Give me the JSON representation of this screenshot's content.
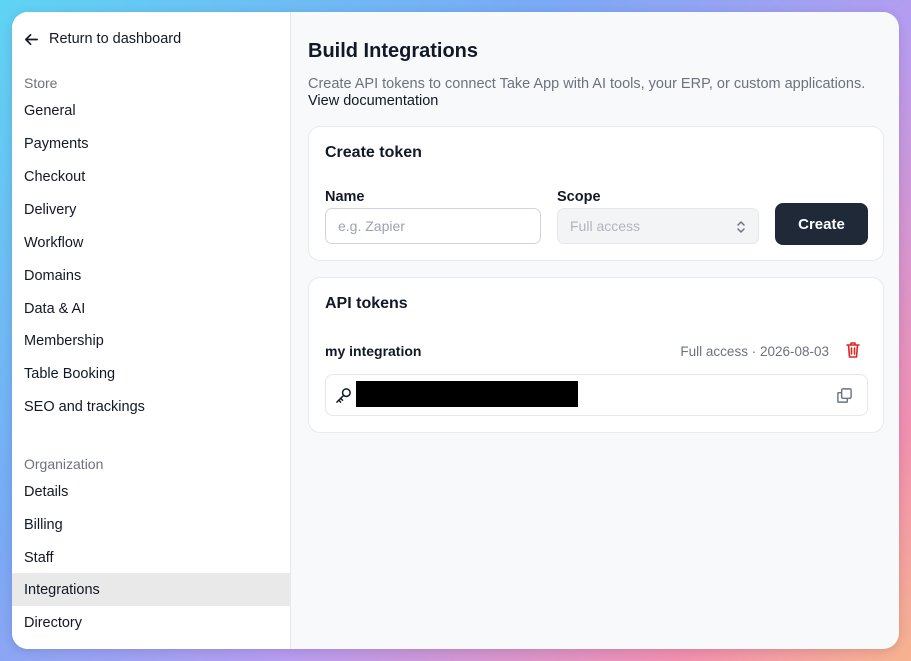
{
  "sidebar": {
    "back_label": "Return to dashboard",
    "store_label": "Store",
    "store_items": [
      "General",
      "Payments",
      "Checkout",
      "Delivery",
      "Workflow",
      "Domains",
      "Data & AI",
      "Membership",
      "Table Booking",
      "SEO and trackings"
    ],
    "org_label": "Organization",
    "org_items": [
      "Details",
      "Billing",
      "Staff",
      "Integrations",
      "Directory"
    ],
    "active_item": "Integrations"
  },
  "main": {
    "title": "Build Integrations",
    "description": "Create API tokens to connect Take App with AI tools, your ERP, or custom applications.",
    "doc_link": "View documentation",
    "create_card": {
      "title": "Create token",
      "name_label": "Name",
      "name_placeholder": "e.g. Zapier",
      "name_value": "",
      "scope_label": "Scope",
      "scope_value": "Full access",
      "create_button": "Create"
    },
    "tokens_card": {
      "title": "API tokens",
      "tokens": [
        {
          "name": "my integration",
          "meta": "Full access · 2026-08-03"
        }
      ]
    }
  },
  "colors": {
    "primary_button": "#1f2937",
    "danger": "#dc2626",
    "active_nav_bg": "#e9e9ea"
  }
}
